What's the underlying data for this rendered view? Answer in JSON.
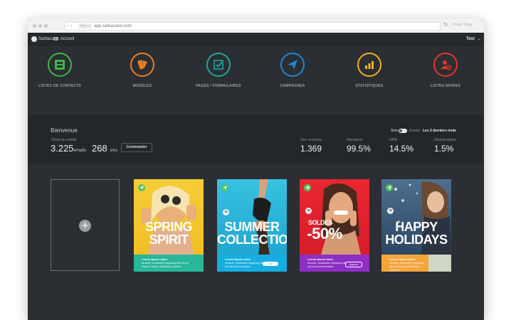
{
  "browser": {
    "url_prefix": "https://",
    "url": "app.sarbacane.com",
    "home_label": "Home Page"
  },
  "app": {
    "brand": "Sarbacane",
    "home": "Accueil",
    "user": "Test"
  },
  "modules": [
    {
      "label": "LISTES DE CONTACTS",
      "icon": "contacts-icon",
      "color": "#3fb54a"
    },
    {
      "label": "MODÈLES",
      "icon": "templates-icon",
      "color": "#f07d1e"
    },
    {
      "label": "PAGES / FORMULAIRES",
      "icon": "form-check-icon",
      "color": "#1fa7a3"
    },
    {
      "label": "CAMPAGNES",
      "icon": "paper-plane-icon",
      "color": "#1e87d6"
    },
    {
      "label": "STATISTIQUES",
      "icon": "bar-chart-icon",
      "color": "#f2b219"
    },
    {
      "label": "LISTES NOIRES",
      "icon": "blacklist-icon",
      "color": "#e5352d"
    }
  ],
  "stats": {
    "welcome": "Bienvenue",
    "stock_label": "Stock de crédits",
    "emails_value": "3.225",
    "emails_unit": "emails",
    "sms_value": "268",
    "sms_unit": "sms",
    "order_button": "Commander",
    "toggle_left": "Sms",
    "toggle_right": "Emails",
    "period": "Les 3 derniers mois",
    "items": [
      {
        "label": "Ses. envoyés",
        "value": "1.369"
      },
      {
        "label": "Réception",
        "value": "99.5%"
      },
      {
        "label": "NPAI",
        "value": "14.5%"
      },
      {
        "label": "Désinscription",
        "value": "1.5%"
      }
    ]
  },
  "templates": {
    "add_symbol": "+",
    "cards": [
      {
        "headline": [
          "SPRING",
          "SPIRIT"
        ],
        "footer_title": "Lorem Ipsum dolor",
        "footer_body": "sit amet, consectetur adipiscing elit sed do eiusmod tempor incididunt ut labore",
        "button": "",
        "photo_color": "#f2c12e",
        "footer_color": "#29b79a"
      },
      {
        "headline": [
          "SUMMER",
          "COLLECTION"
        ],
        "footer_title": "Lorem Ipsum dolor",
        "footer_body": "sit amet, consectetur adipiscing elit, sed do eiusmod tempor",
        "button": "Lien",
        "photo_color": "#2fb6d9",
        "footer_color": "#16aee0"
      },
      {
        "headline": [
          "SOLDES",
          "-50%"
        ],
        "footer_title": "Lorem Ipsum dolor",
        "footer_body": "sit amet, consectetur adipiscing elit, sed do eiusmod tempor",
        "button": "Ingresar",
        "photo_color": "#e7262f",
        "footer_color": "#8e2fc4"
      },
      {
        "headline": [
          "HAPPY",
          "HOLIDAYS"
        ],
        "footer_title": "Lorem Ipsum dolor",
        "footer_body": "sit amet, consectetur adipiscing elit, sed do eiusmod tempor incididunt",
        "button": "",
        "photo_color": "#3a5a7a",
        "footer_color": "#f4a53a"
      }
    ]
  }
}
